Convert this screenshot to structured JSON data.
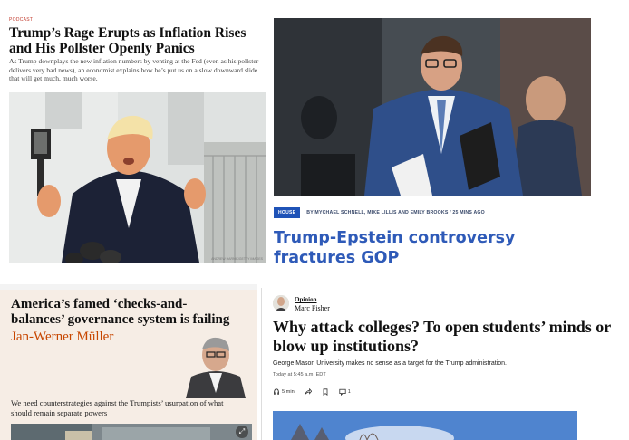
{
  "tnr": {
    "kicker": "PODCAST",
    "headline": "Trump’s Rage Erupts as Inflation Rises and His Pollster Openly Panics",
    "dek": "As Trump downplays the new inflation numbers by venting at the Fed (even as his pollster delivers very bad news), an economist explains how he’s put us on a slow downward slide that will get much, much worse.",
    "photo_credit": "ANDREW HARNIK/GETTY IMAGES"
  },
  "hill": {
    "section_tag": "HOUSE",
    "byline": "BY MYCHAEL SCHNELL, MIKE LILLIS AND EMILY BROOKS / 25 MINS AGO",
    "headline": "Trump-Epstein controversy fractures GOP"
  },
  "guardian": {
    "headline": "America’s famed ‘checks-and-balances’ governance system is failing",
    "author": "Jan-Werner Müller",
    "trail": "We need counterstrategies against the Trumpists’ usurpation of what should remain separate powers",
    "expand_icon": "expand-icon"
  },
  "wapo": {
    "section": "Opinion",
    "writer": "Marc Fisher",
    "headline": "Why attack colleges? To open students’ minds or blow up institutions?",
    "dek": "George Mason University makes no sense as a target for the Trump administration.",
    "time": "Today at 5:45 a.m. EDT",
    "listen_label": "5 min",
    "comment_count": "1"
  },
  "colors": {
    "hill_blue": "#2e5ab8",
    "hill_tag": "#1f53b7",
    "guardian_bg": "#f6ede5",
    "guardian_author": "#c74600",
    "tnr_kicker": "#c0392b"
  }
}
